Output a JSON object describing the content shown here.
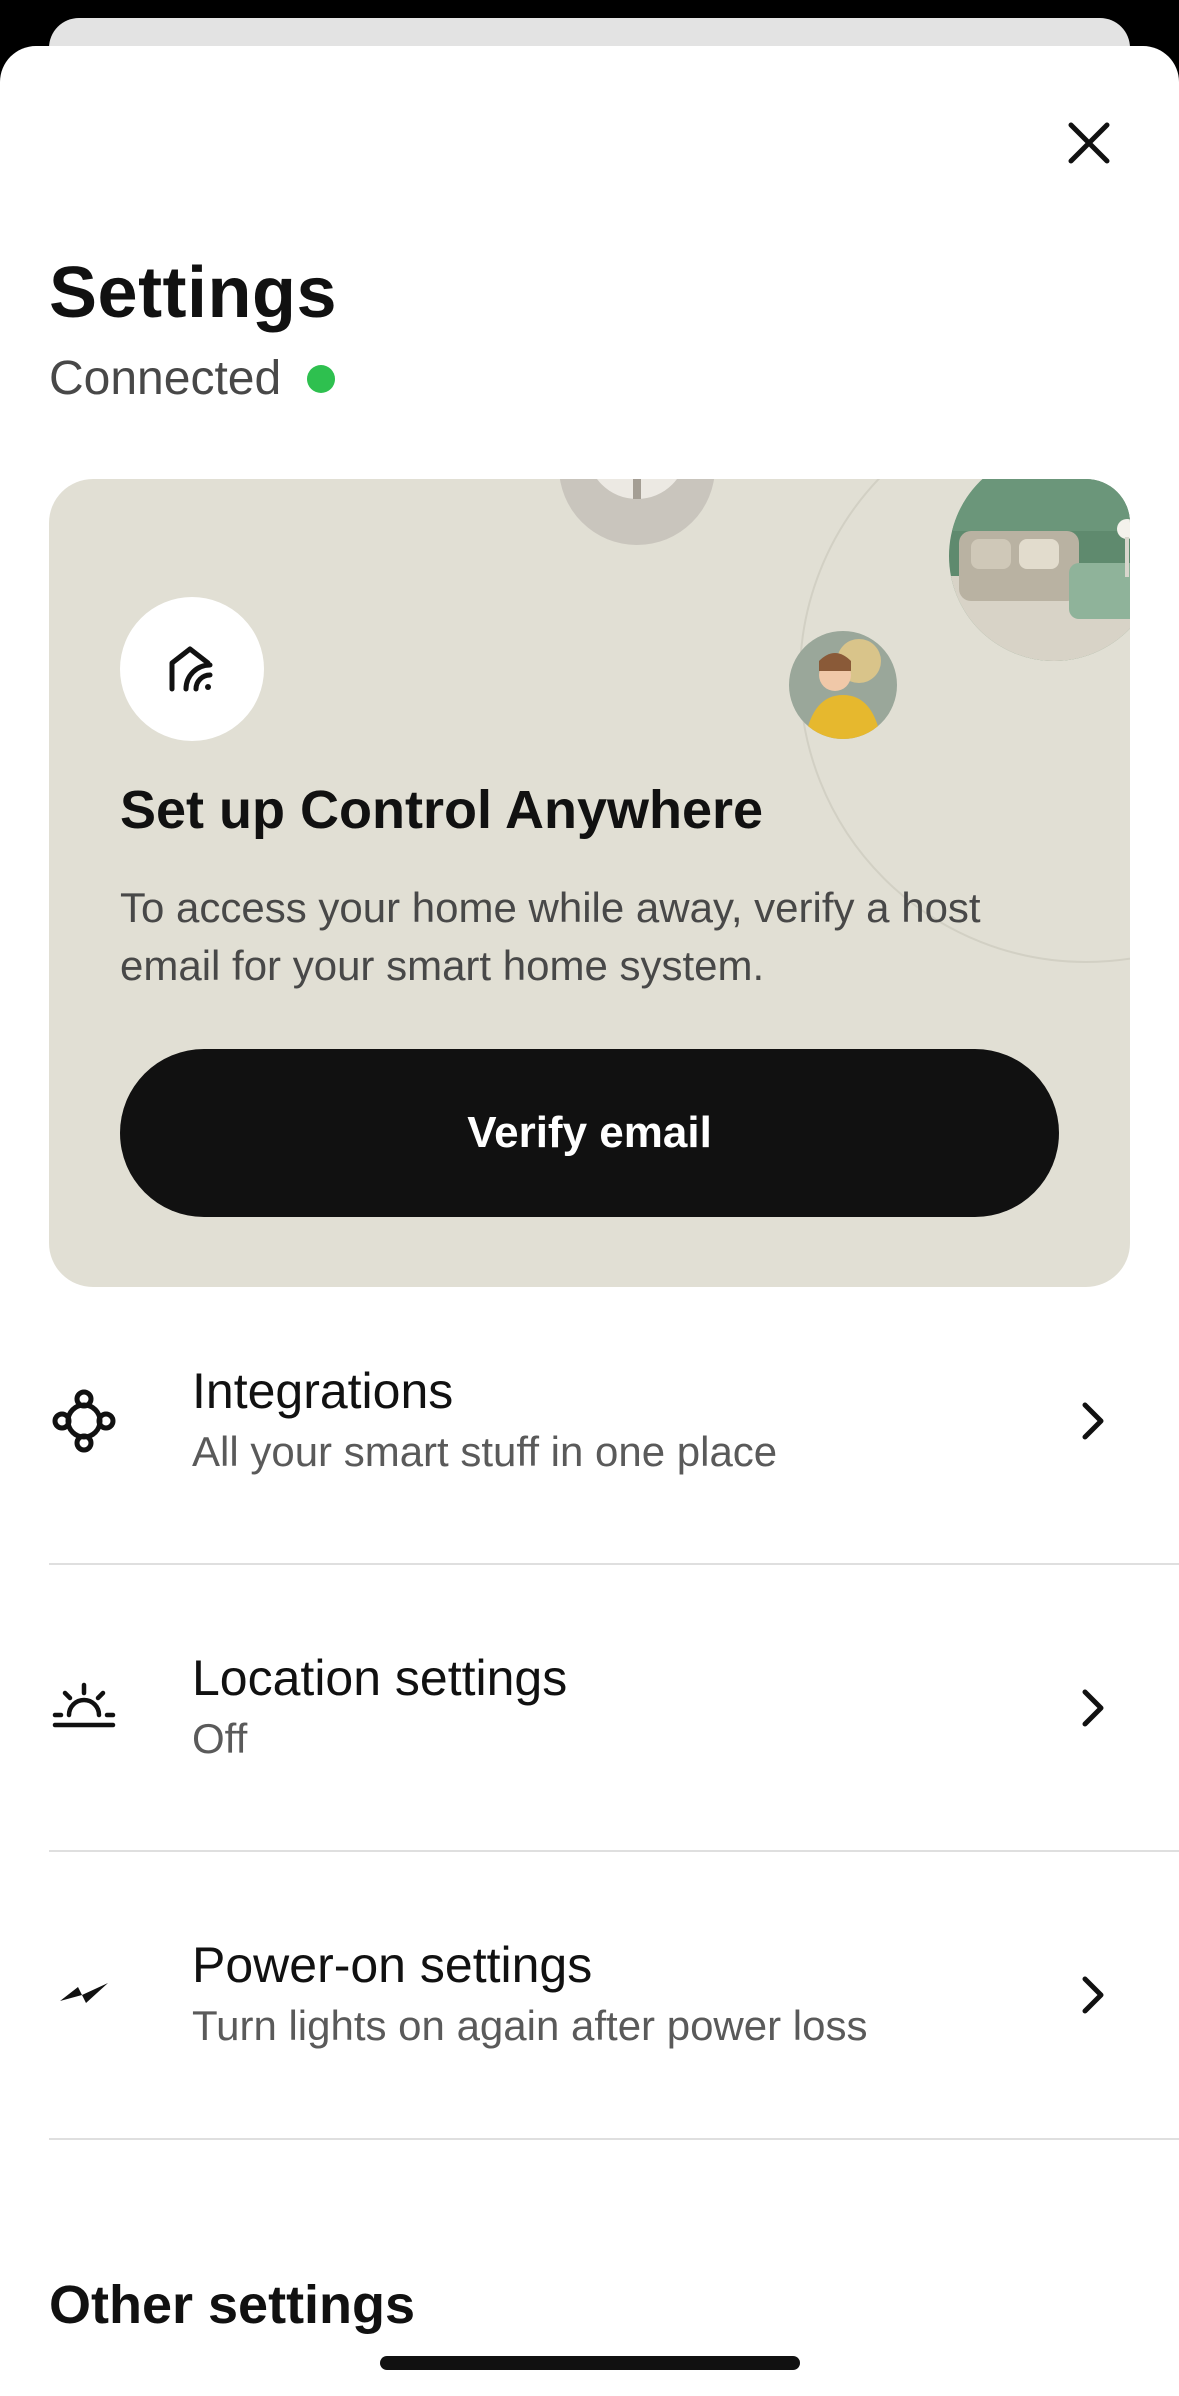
{
  "header": {
    "title": "Settings",
    "status": "Connected",
    "status_color": "#2ec04f"
  },
  "close_button": {
    "icon": "close-icon"
  },
  "promo_card": {
    "icon": "home-wifi-icon",
    "title": "Set up Control Anywhere",
    "description": "To access your home while away, verify a host email for your smart home system.",
    "button_label": "Verify email",
    "background_color": "#e1dfd4"
  },
  "settings_list": [
    {
      "icon": "integrations-icon",
      "title": "Integrations",
      "subtitle": "All your smart stuff in one place"
    },
    {
      "icon": "sunrise-icon",
      "title": "Location settings",
      "subtitle": "Off"
    },
    {
      "icon": "power-icon",
      "title": "Power-on settings",
      "subtitle": "Turn lights on again after power loss"
    }
  ],
  "other_settings": {
    "title": "Other settings"
  }
}
